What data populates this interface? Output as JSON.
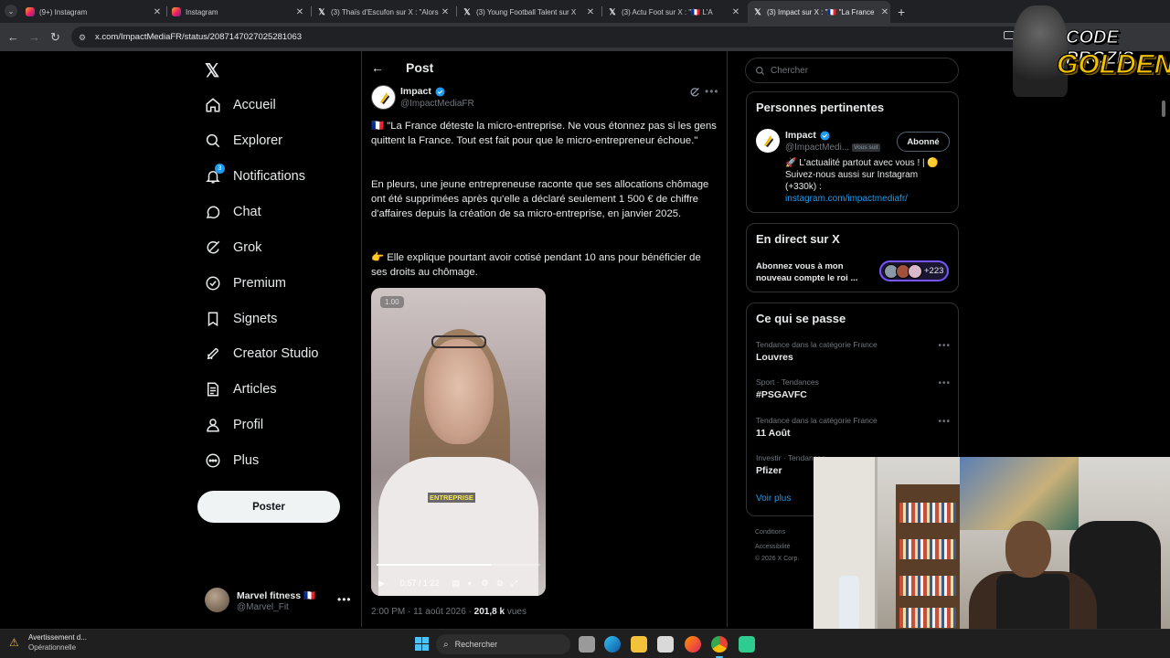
{
  "browser": {
    "tabs": [
      {
        "title": "(9+) Instagram",
        "icon": "instagram-icon"
      },
      {
        "title": "Instagram",
        "icon": "instagram-icon"
      },
      {
        "title": "(3) Thaïs d'Escufon sur X : \"Alors",
        "icon": "x-icon"
      },
      {
        "title": "(3) Young Football Talent sur X",
        "icon": "x-icon"
      },
      {
        "title": "(3) Actu Foot sur X : \"🇫🇷 L'A",
        "icon": "x-icon"
      },
      {
        "title": "(3) Impact sur X : \"🇫🇷 \"La France",
        "icon": "x-icon"
      }
    ],
    "url": "x.com/ImpactMediaFR/status/2087147027025281063"
  },
  "nav": {
    "items": [
      {
        "label": "Accueil",
        "icon": "home-icon"
      },
      {
        "label": "Explorer",
        "icon": "search-icon"
      },
      {
        "label": "Notifications",
        "icon": "bell-icon",
        "badge": "3"
      },
      {
        "label": "Chat",
        "icon": "chat-icon"
      },
      {
        "label": "Grok",
        "icon": "grok-icon"
      },
      {
        "label": "Premium",
        "icon": "premium-icon"
      },
      {
        "label": "Signets",
        "icon": "bookmark-icon"
      },
      {
        "label": "Creator Studio",
        "icon": "rocket-icon"
      },
      {
        "label": "Articles",
        "icon": "article-icon"
      },
      {
        "label": "Profil",
        "icon": "profile-icon"
      },
      {
        "label": "Plus",
        "icon": "more-icon"
      }
    ],
    "post_button": "Poster",
    "account": {
      "name": "Marvel fitness 🇫🇷",
      "handle": "@Marvel_Fit"
    }
  },
  "post": {
    "header": "Post",
    "author_name": "Impact",
    "author_handle": "@ImpactMediaFR",
    "para1": "🇫🇷 \"La France déteste la micro-entreprise. Ne vous étonnez pas si les gens quittent la France. Tout est fait pour que le micro-entrepreneur échoue.\"",
    "para2": "En pleurs, une jeune entrepreneuse raconte que ses allocations chômage ont été supprimées après qu'elle a déclaré seulement 1 500 € de chiffre d'affaires depuis la création de sa micro-entreprise, en janvier 2025.",
    "para3": "👉 Elle explique pourtant avoir cotisé pendant 10 ans pour bénéficier de ses droits au chômage.",
    "video": {
      "speed": "1.00",
      "time": "0:57 / 1:22",
      "progress": 0.7,
      "caption": "ENTREPRISE"
    },
    "meta_time": "2:00 PM · 11 août 2026 · ",
    "meta_views": "201,8 k",
    "meta_views_label": " vues"
  },
  "sidebar": {
    "search_placeholder": "Chercher",
    "relevant": {
      "title": "Personnes pertinentes",
      "name": "Impact",
      "handle": "@ImpactMedi...",
      "follows_you": "Vous suit",
      "button": "Abonné",
      "bio": "🚀 L'actualité partout avec vous ! | 🟡 Suivez-nous aussi sur Instagram (+330k) :",
      "link": "instagram.com/impactmediafr/"
    },
    "live": {
      "title": "En direct sur X",
      "text": "Abonnez vous à mon nouveau compte le roi ...",
      "count": "+223"
    },
    "trends": {
      "title": "Ce qui se passe",
      "items": [
        {
          "category": "Tendance dans la catégorie France",
          "topic": "Louvres"
        },
        {
          "category": "Sport · Tendances",
          "topic": "#PSGAVFC"
        },
        {
          "category": "Tendance dans la catégorie France",
          "topic": "11 Août"
        },
        {
          "category": "Investir · Tendances",
          "topic": "Pfizer"
        }
      ],
      "more": "Voir plus"
    },
    "footer": [
      "Conditions",
      "Accessibilité",
      "© 2026 X Corp."
    ]
  },
  "overlay": {
    "logo_line1": "CODE PROZIS",
    "logo_line2": "GOLDENG"
  },
  "taskbar": {
    "alert_title": "Avertissement d...",
    "alert_sub": "Opérationnelle",
    "search": "Rechercher"
  },
  "colors": {
    "accent": "#1d9bf0",
    "background": "#000000",
    "live_border": "#7856ff"
  }
}
